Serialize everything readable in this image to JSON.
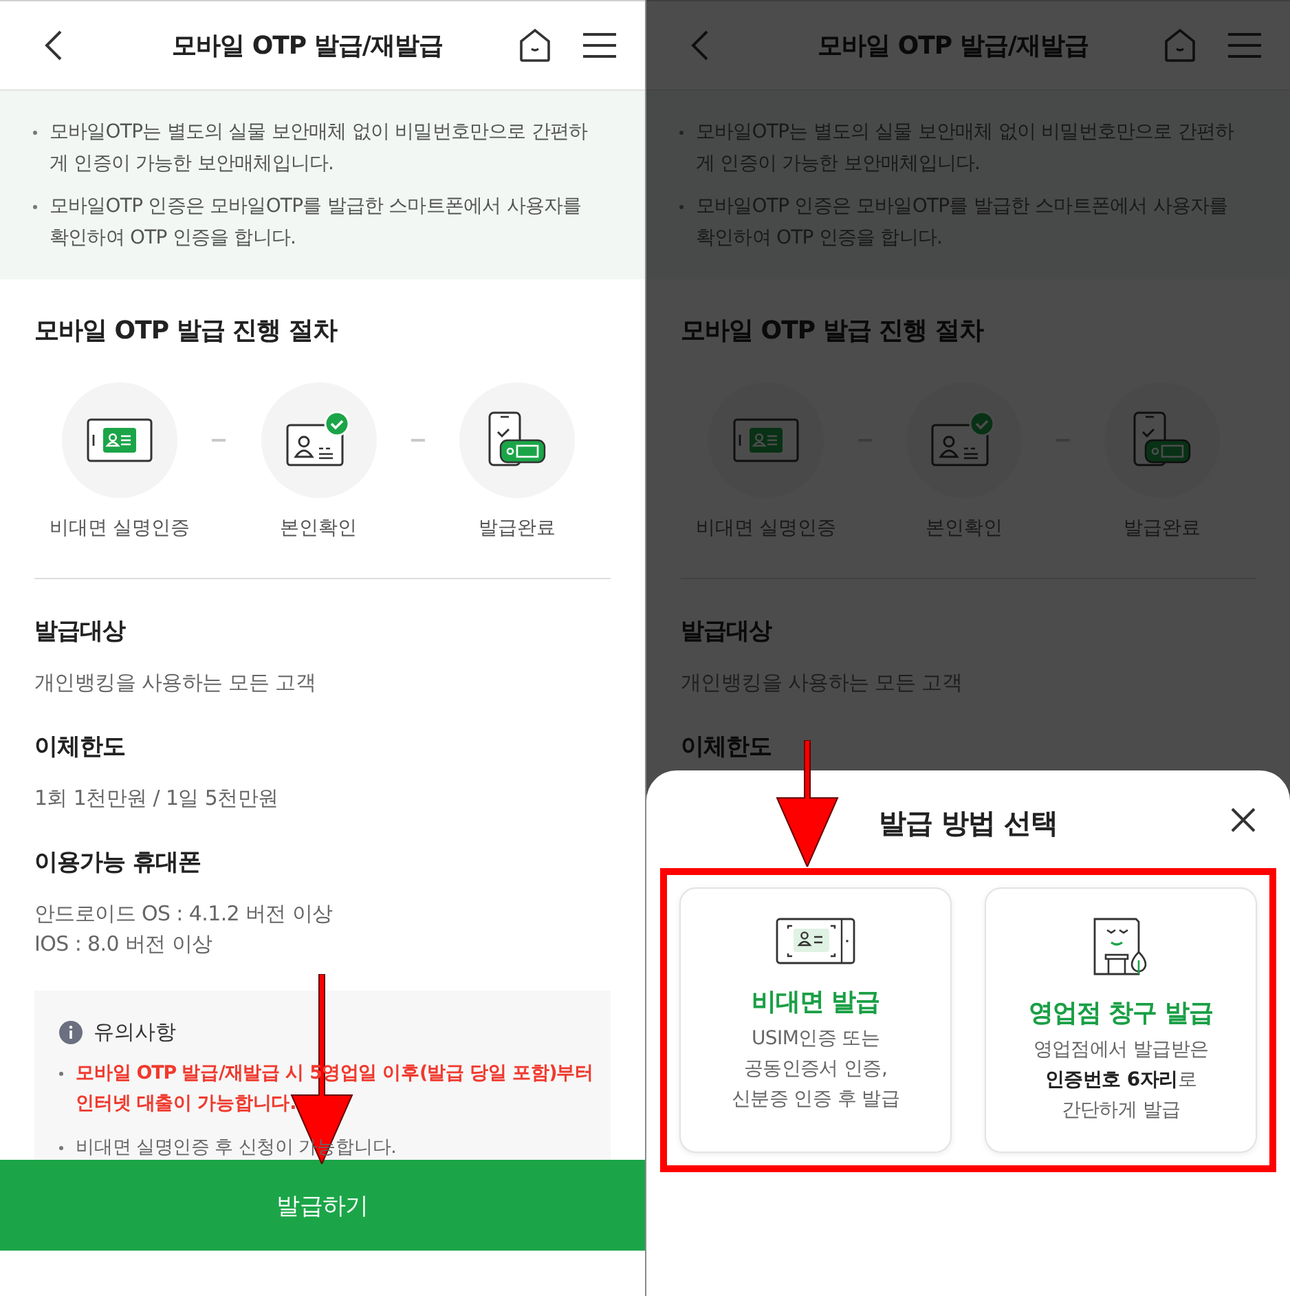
{
  "left_screen": {
    "header": {
      "title": "모바일 OTP 발급/재발급"
    },
    "intro": [
      "모바일OTP는 별도의 실물 보안매체 없이 비밀번호만으로 간편하게 인증이 가능한 보안매체입니다.",
      "모바일OTP 인증은 모바일OTP를 발급한 스마트폰에서 사용자를 확인하여 OTP 인증을 합니다."
    ],
    "procedure": {
      "title": "모바일 OTP 발급 진행 절차",
      "steps": [
        {
          "label": "비대면 실명인증",
          "kind": "id-scan"
        },
        {
          "label": "본인확인",
          "kind": "id-check"
        },
        {
          "label": "발급완료",
          "kind": "phone-otp"
        }
      ]
    },
    "sections": [
      {
        "heading": "발급대상",
        "lines": [
          "개인뱅킹을 사용하는 모든 고객"
        ]
      },
      {
        "heading": "이체한도",
        "lines": [
          "1회 1천만원 / 1일 5천만원"
        ]
      },
      {
        "heading": "이용가능 휴대폰",
        "lines": [
          "안드로이드 OS : 4.1.2 버전 이상",
          "IOS : 8.0 버전 이상"
        ]
      }
    ],
    "notice": {
      "title": "유의사항",
      "items": [
        {
          "text": "모바일 OTP 발급/재발급 시 5영업일 이후(발급 당일 포함)부터 인터넷 대출이 가능합니다.",
          "important": true
        },
        {
          "text": "비대면 실명인증 후 신청이 가능합니다.",
          "important": false
        }
      ]
    },
    "button": {
      "label": "발급하기"
    }
  },
  "right_screen": {
    "background": {
      "header": {
        "title": "모바일 OTP 발급/재발급"
      },
      "intro": [
        "모바일OTP는 별도의 실물 보안매체 없이 비밀번호만으로 간편하게 인증이 가능한 보안매체입니다.",
        "모바일OTP 인증은 모바일OTP를 발급한 스마트폰에서 사용자를 확인하여 OTP 인증을 합니다."
      ],
      "procedure": {
        "title": "모바일 OTP 발급 진행 절차",
        "steps": [
          {
            "label": "비대면 실명인증",
            "kind": "id-scan"
          },
          {
            "label": "본인확인",
            "kind": "id-check"
          },
          {
            "label": "발급완료",
            "kind": "phone-otp"
          }
        ]
      },
      "sections": [
        {
          "heading": "발급대상",
          "lines": [
            "개인뱅킹을 사용하는 모든 고객"
          ]
        },
        {
          "heading": "이체한도"
        }
      ]
    },
    "sheet": {
      "title": "발급 방법 선택",
      "options": [
        {
          "kind": "non-face",
          "title": "비대면 발급",
          "description": "USIM인증 또는\n공동인증서 인증,\n신분증 인증 후 발급"
        },
        {
          "kind": "branch",
          "title": "영업점 창구 발급",
          "description": "영업점에서 발급받은\n**인증번호 6자리**로\n간단하게 발급"
        }
      ]
    }
  }
}
